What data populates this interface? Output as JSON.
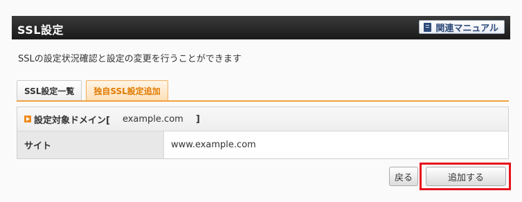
{
  "header": {
    "title": "SSL設定",
    "manual_label": "関連マニュアル"
  },
  "description": "SSLの設定状況確認と設定の変更を行うことができます",
  "tabs": [
    {
      "label": "SSL設定一覧",
      "active": false
    },
    {
      "label": "独自SSL設定追加",
      "active": true
    }
  ],
  "panel": {
    "head_prefix": "設定対象ドメイン[",
    "domain": "example.com",
    "head_suffix": "]",
    "row_label": "サイト",
    "row_value": "www.example.com"
  },
  "buttons": {
    "back_label": "戻る",
    "add_label": "追加する"
  },
  "colors": {
    "header_bg": "#1a1a1a",
    "accent_orange": "#f08a1c",
    "highlight_red": "#e8101a"
  }
}
